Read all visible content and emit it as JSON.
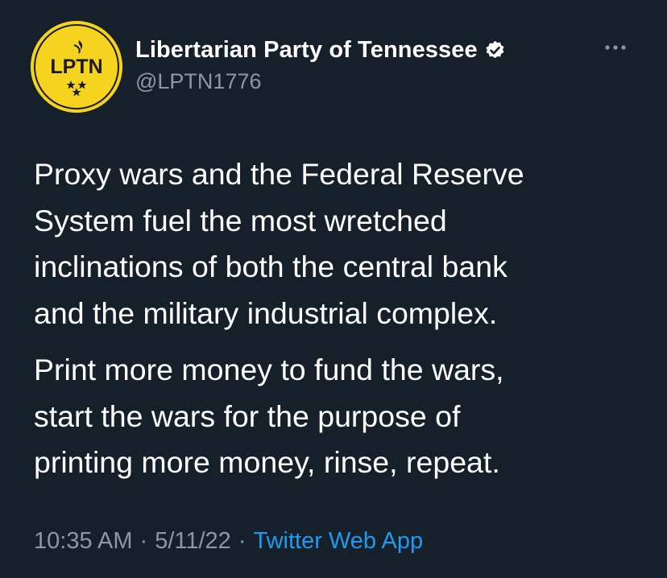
{
  "author": {
    "name": "Libertarian Party of Tennessee",
    "handle": "@LPTN1776",
    "avatar_text": "LPTN",
    "avatar_color": "#f5d31f",
    "verified": true,
    "verified_icon": "verified-badge-icon"
  },
  "menu": {
    "icon": "more-horizontal-icon"
  },
  "tweet": {
    "paragraphs": [
      "Proxy wars and the Federal Reserve\nSystem fuel the most wretched\ninclinations of both the central bank\nand the military industrial complex.",
      "Print more money to fund the wars,\nstart the wars for the purpose of\nprinting more money, rinse, repeat."
    ]
  },
  "meta": {
    "time": "10:35 AM",
    "separator": "·",
    "date": "5/11/22",
    "source": "Twitter Web App"
  },
  "colors": {
    "background": "#15202b",
    "secondary_text": "#8b98a5",
    "link": "#1d9bf0"
  }
}
